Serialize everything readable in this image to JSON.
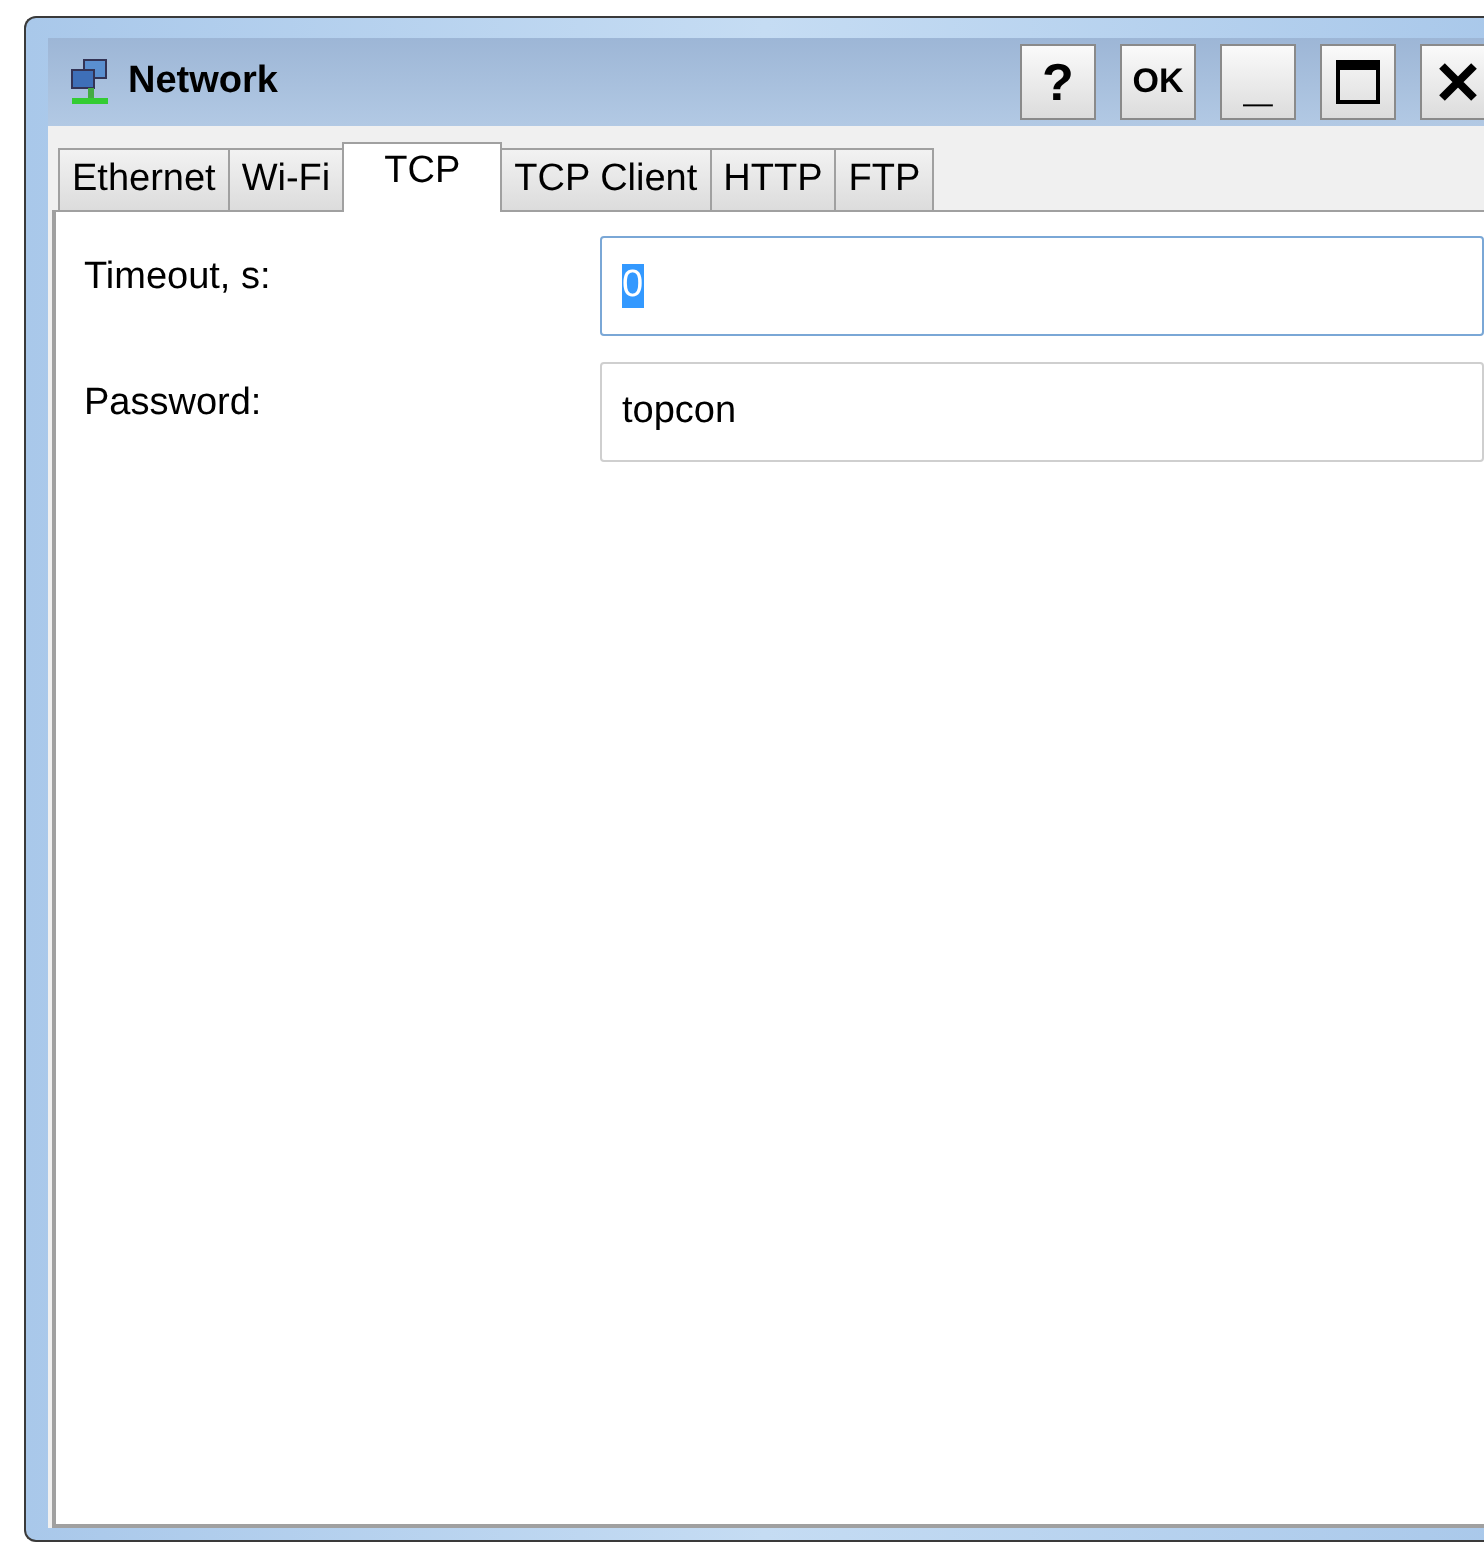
{
  "window": {
    "title": "Network"
  },
  "title_buttons": [
    {
      "kind": "text",
      "label": "?"
    },
    {
      "kind": "text",
      "label": "OK"
    },
    {
      "kind": "text",
      "label": "_"
    },
    {
      "kind": "maximize"
    },
    {
      "kind": "close"
    }
  ],
  "tabs": [
    {
      "label": "Ethernet",
      "selected": false
    },
    {
      "label": "Wi-Fi",
      "selected": false
    },
    {
      "label": "TCP",
      "selected": true
    },
    {
      "label": "TCP Client",
      "selected": false
    },
    {
      "label": "HTTP",
      "selected": false
    },
    {
      "label": "FTP",
      "selected": false
    }
  ],
  "fields": [
    {
      "label": "Timeout, s:",
      "value": "0",
      "focused": true,
      "text_selected": true
    },
    {
      "label": "Password:",
      "value": "topcon",
      "focused": false,
      "text_selected": false
    }
  ]
}
